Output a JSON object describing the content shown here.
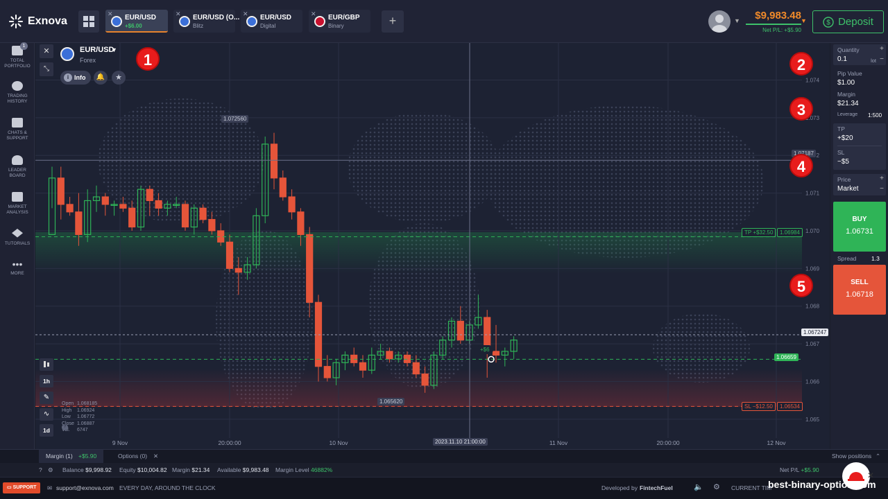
{
  "brand": {
    "name": "Exnova"
  },
  "tabs": [
    {
      "name": "EUR/USD",
      "sub": "+$6.00",
      "active": true
    },
    {
      "name": "EUR/USD (O...",
      "sub": "Blitz"
    },
    {
      "name": "EUR/USD",
      "sub": "Digital"
    },
    {
      "name": "EUR/GBP",
      "sub": "Binary"
    }
  ],
  "account": {
    "balance": "$9,983.48",
    "net_pl": "Net P/L: +$5.90",
    "deposit_label": "Deposit"
  },
  "sidebar": {
    "badge": "1",
    "items": [
      {
        "label1": "TOTAL",
        "label2": "PORTFOLIO"
      },
      {
        "label1": "TRADING",
        "label2": "HISTORY"
      },
      {
        "label1": "CHATS &",
        "label2": "SUPPORT"
      },
      {
        "label1": "LEADER",
        "label2": "BOARD"
      },
      {
        "label1": "MARKET",
        "label2": "ANALYSIS"
      },
      {
        "label1": "TUTORIALS",
        "label2": ""
      },
      {
        "label1": "MORE",
        "label2": ""
      }
    ]
  },
  "instrument": {
    "pair": "EUR/USD",
    "type": "Forex",
    "info_label": "Info"
  },
  "chart_toolbar": {
    "timeframe": "1h",
    "period": "1d"
  },
  "ohlc": {
    "open_label": "Open",
    "open": "1.068185",
    "high_label": "High",
    "high": "1.06924",
    "low_label": "Low",
    "low": "1.06772",
    "close_label": "Close",
    "close": "1.06887",
    "vol_label": "Vol.",
    "vol": "6747"
  },
  "chart_labels": {
    "high_marker": "1.072560",
    "low_marker": "1.065620",
    "tp_tag": "TP",
    "tp_value": "+$32.50",
    "tp_price": "1.06984",
    "sl_tag": "SL",
    "sl_value": "−$12.50",
    "sl_price": "1.06534",
    "current_price": "1.06724",
    "current_price_end": "7",
    "entry_price": "1.06659",
    "crosshair_price": "1.07187",
    "trade_pl": "+$6",
    "crosshair_time": "2023.11.10 21:00:00"
  },
  "chart_data": {
    "type": "candlestick",
    "y_ticks": [
      "1.074",
      "1.073",
      "1.072",
      "1.071",
      "1.070",
      "1.069",
      "1.068",
      "1.067",
      "1.066",
      "1.065"
    ],
    "x_ticks": [
      "9 Nov",
      "20:00:00",
      "10 Nov",
      "11 Nov",
      "20:00:00",
      "12 Nov"
    ],
    "ylim": [
      1.0645,
      1.0748
    ],
    "up_color": "#2fb457",
    "down_color": "#e5553a",
    "candles": [
      [
        1.0699,
        1.0717,
        1.0706,
        1.0714
      ],
      [
        1.0714,
        1.0717,
        1.0703,
        1.0707
      ],
      [
        1.0707,
        1.0709,
        1.0704,
        1.0705
      ],
      [
        1.0705,
        1.071,
        1.0696,
        1.0699
      ],
      [
        1.0699,
        1.0711,
        1.0697,
        1.0708
      ],
      [
        1.0708,
        1.0712,
        1.0705,
        1.0709
      ],
      [
        1.0709,
        1.071,
        1.0704,
        1.0707
      ],
      [
        1.0707,
        1.0708,
        1.0704,
        1.0707
      ],
      [
        1.0707,
        1.0709,
        1.0705,
        1.0706
      ],
      [
        1.0706,
        1.0708,
        1.07,
        1.0701
      ],
      [
        1.0701,
        1.0712,
        1.07,
        1.0711
      ],
      [
        1.0711,
        1.0712,
        1.0704,
        1.0708
      ],
      [
        1.0708,
        1.071,
        1.0704,
        1.0706
      ],
      [
        1.0706,
        1.0708,
        1.0704,
        1.0707
      ],
      [
        1.0707,
        1.0709,
        1.0706,
        1.0707
      ],
      [
        1.0707,
        1.0708,
        1.07,
        1.0701
      ],
      [
        1.0701,
        1.0707,
        1.0699,
        1.0706
      ],
      [
        1.0706,
        1.0707,
        1.0702,
        1.0703
      ],
      [
        1.0703,
        1.0705,
        1.0699,
        1.07
      ],
      [
        1.07,
        1.0702,
        1.0696,
        1.0697
      ],
      [
        1.0697,
        1.0699,
        1.0689,
        1.069
      ],
      [
        1.069,
        1.0693,
        1.0683,
        1.0689
      ],
      [
        1.0689,
        1.0693,
        1.0687,
        1.0691
      ],
      [
        1.0691,
        1.0706,
        1.069,
        1.0704
      ],
      [
        1.0704,
        1.0725,
        1.0702,
        1.0723
      ],
      [
        1.0723,
        1.0726,
        1.0711,
        1.0714
      ],
      [
        1.0714,
        1.0716,
        1.0708,
        1.0709
      ],
      [
        1.0709,
        1.0711,
        1.0703,
        1.0705
      ],
      [
        1.0705,
        1.0706,
        1.0696,
        1.0699
      ],
      [
        1.0699,
        1.0701,
        1.0677,
        1.0681
      ],
      [
        1.0681,
        1.0683,
        1.066,
        1.0664
      ],
      [
        1.0664,
        1.0667,
        1.066,
        1.0661
      ],
      [
        1.0661,
        1.0666,
        1.0659,
        1.0665
      ],
      [
        1.0665,
        1.0668,
        1.0663,
        1.0667
      ],
      [
        1.0667,
        1.0669,
        1.0664,
        1.0665
      ],
      [
        1.0665,
        1.0667,
        1.0661,
        1.0663
      ],
      [
        1.0663,
        1.0669,
        1.0662,
        1.0667
      ],
      [
        1.0667,
        1.067,
        1.0666,
        1.0668
      ],
      [
        1.0668,
        1.0669,
        1.0665,
        1.0666
      ],
      [
        1.0666,
        1.0668,
        1.0665,
        1.0667
      ],
      [
        1.0667,
        1.0668,
        1.0664,
        1.0665
      ],
      [
        1.0665,
        1.0667,
        1.0661,
        1.0662
      ],
      [
        1.0662,
        1.0664,
        1.0657,
        1.0659
      ],
      [
        1.0659,
        1.0668,
        1.0658,
        1.0667
      ],
      [
        1.0667,
        1.0672,
        1.0666,
        1.0671
      ],
      [
        1.0671,
        1.0677,
        1.0669,
        1.0676
      ],
      [
        1.0676,
        1.068,
        1.067,
        1.0671
      ],
      [
        1.0671,
        1.0676,
        1.067,
        1.0675
      ],
      [
        1.0675,
        1.0683,
        1.0674,
        1.0677
      ],
      [
        1.0677,
        1.0679,
        1.0661,
        1.0668
      ],
      [
        1.0668,
        1.0675,
        1.0665,
        1.0667
      ],
      [
        1.0667,
        1.0669,
        1.0664,
        1.0668
      ],
      [
        1.0668,
        1.0672,
        1.0666,
        1.0671
      ]
    ]
  },
  "order_panel": {
    "quantity_label": "Quantity",
    "quantity": "0.1",
    "quantity_unit": "lot",
    "pip_label": "Pip Value",
    "pip_value": "$1.00",
    "margin_label": "Margin",
    "margin_value": "$21.34",
    "leverage_label": "Leverage",
    "leverage": "1:500",
    "tp_label": "TP",
    "tp_value": "+$20",
    "sl_label": "SL",
    "sl_value": "−$5",
    "price_label": "Price",
    "price_value": "Market",
    "buy_label": "BUY",
    "buy_price": "1.06731",
    "spread_label": "Spread",
    "spread": "1.3",
    "sell_label": "SELL",
    "sell_price": "1.06718"
  },
  "steps": [
    "1",
    "2",
    "3",
    "4",
    "5"
  ],
  "bottom": {
    "margin_tab": "Margin (1)",
    "margin_tab_pl": "+$5.90",
    "options_tab": "Options (0)",
    "show_positions": "Show positions",
    "balance_label": "Balance",
    "balance": "$9,998.92",
    "equity_label": "Equity",
    "equity": "$10,004.82",
    "margin_label": "Margin",
    "margin": "$21.34",
    "available_label": "Available",
    "available": "$9,983.48",
    "margin_level_label": "Margin Level",
    "margin_level": "46882%",
    "net_pl_label": "Net P/L",
    "net_pl": "+$5.90",
    "support_label": "SUPPORT",
    "email": "support@exnova.com",
    "schedule": "EVERY DAY, AROUND THE CLOCK",
    "developed_by": "Developed by",
    "developer": "FintechFuel",
    "current_time": "CURRENT TIM",
    "watermark": "best-binary-option.com"
  }
}
